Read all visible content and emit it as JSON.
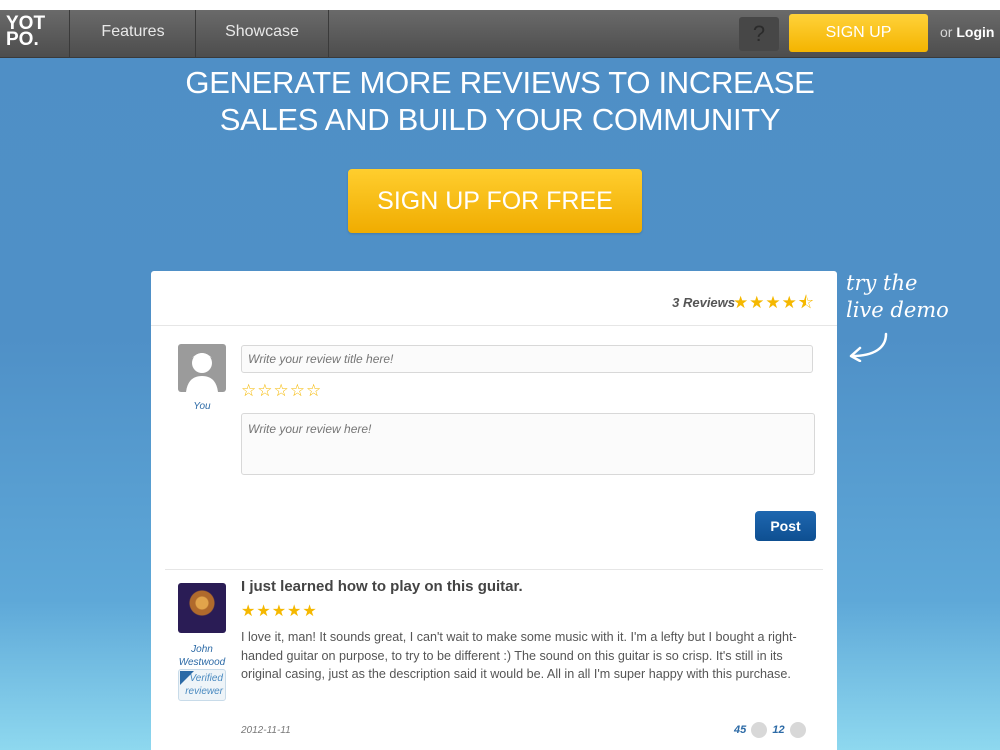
{
  "nav": {
    "logo_line1": "YOT",
    "logo_line2": "PO.",
    "items": [
      {
        "label": "Features"
      },
      {
        "label": "Showcase"
      }
    ],
    "help_label": "?",
    "signup_label": "SIGN UP",
    "or_label": "or",
    "login_label": "Login"
  },
  "hero": {
    "title_line1": "GENERATE MORE REVIEWS TO INCREASE",
    "title_line2": "SALES AND BUILD YOUR COMMUNITY",
    "cta_label": "SIGN UP FOR FREE",
    "demo_line1": "try the",
    "demo_line2": "live demo"
  },
  "widget": {
    "review_count": "3 Reviews",
    "average_rating": 4.5,
    "average_stars": "★★★★⯪",
    "form": {
      "user_label": "You",
      "title_placeholder": "Write your review title here!",
      "rating_stars": "☆☆☆☆☆",
      "body_placeholder": "Write your review here!",
      "post_label": "Post"
    },
    "review": {
      "author_line1": "John",
      "author_line2": "Westwood",
      "badge_line1": "Verified",
      "badge_line2": "reviewer",
      "title": "I just learned how to play on this guitar.",
      "rating": 5,
      "stars": "★★★★★",
      "body": "I love it, man! It sounds great, I can't wait to make some music with it. I'm a lefty but I bought a right-handed guitar on purpose, to try to be different :) The sound on this guitar is so crisp. It's still in its original casing, just as the description said it would be. All in all I'm super happy with this purchase.",
      "date": "2012-11-11",
      "upvotes": "45",
      "downvotes": "12"
    }
  },
  "colors": {
    "accent_yellow": "#f4b400",
    "post_blue": "#0e4f91",
    "link_blue": "#2c6aa6",
    "navbar": "#555555",
    "background_blue": "#4f8fc6"
  }
}
